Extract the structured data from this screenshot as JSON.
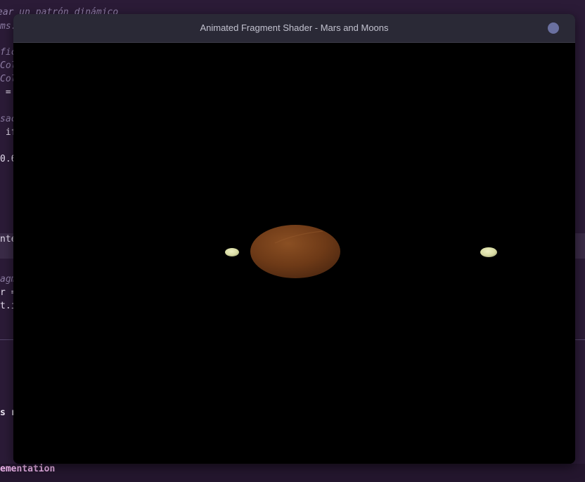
{
  "window": {
    "title": "Animated Fragment Shader - Mars and Moons"
  },
  "background_editor": {
    "lines": [
      {
        "text": "ear un patrón dinámico",
        "style": "cmt"
      },
      {
        "text": "ms.",
        "style": "cmt"
      },
      {
        "text": "fic",
        "style": "cmt"
      },
      {
        "text": "Col",
        "style": "cmt"
      },
      {
        "text": "Col",
        "style": "cmt"
      },
      {
        "text": " =",
        "style": "plain"
      },
      {
        "text": "sac",
        "style": "cmt"
      },
      {
        "text": " if",
        "style": "plain"
      },
      {
        "text": "0.6",
        "style": "plain"
      },
      {
        "text": "nte",
        "style": "plain"
      },
      {
        "text": "agm",
        "style": "cmt"
      },
      {
        "text": "r =",
        "style": "plain"
      },
      {
        "text": "t.i",
        "style": "plain"
      },
      {
        "text": "s r",
        "style": "bold"
      },
      {
        "text": "ementation",
        "style": "pink"
      }
    ]
  },
  "scene": {
    "background_color": "#000000",
    "planet": {
      "name": "Mars",
      "color": "#6e3a17",
      "highlight": "#8a4f23"
    },
    "moons": [
      {
        "name": "moon-left",
        "color": "#d9dca4"
      },
      {
        "name": "moon-right",
        "color": "#d9dca4"
      }
    ]
  }
}
